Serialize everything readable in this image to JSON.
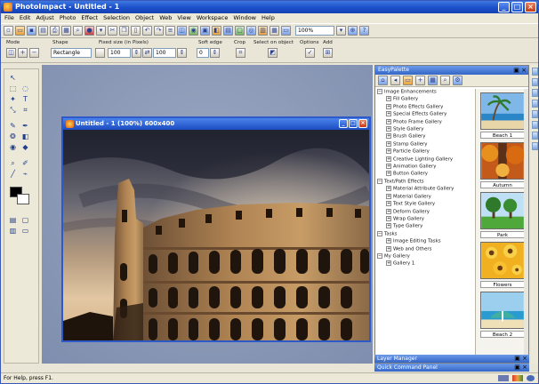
{
  "window": {
    "title": "PhotoImpact - Untitled - 1",
    "buttons": [
      "_",
      "□",
      "×"
    ]
  },
  "menu": [
    "File",
    "Edit",
    "Adjust",
    "Photo",
    "Effect",
    "Selection",
    "Object",
    "Web",
    "View",
    "Workspace",
    "Window",
    "Help"
  ],
  "toolbar": {
    "zoom": "100%"
  },
  "attribute_bar": {
    "mode_label": "Mode",
    "shape_label": "Shape",
    "shape_value": "Rectangle",
    "fixed_size_label": "Fixed size (in Pixels)",
    "width_value": "100",
    "height_value": "100",
    "soft_edge_label": "Soft edge",
    "soft_edge_value": "0",
    "crop_label": "Crop",
    "select_on_object_label": "Select on object",
    "options_label": "Options",
    "add_label": "Add"
  },
  "document": {
    "title": "Untitled - 1 (100%) 600x400"
  },
  "easypalette": {
    "title": "EasyPalette",
    "tree": [
      {
        "label": "Image Enhancements",
        "level": 0
      },
      {
        "label": "Fill Gallery",
        "level": 1
      },
      {
        "label": "Photo Effects Gallery",
        "level": 1
      },
      {
        "label": "Special Effects Gallery",
        "level": 1
      },
      {
        "label": "Photo Frame Gallery",
        "level": 1
      },
      {
        "label": "Style Gallery",
        "level": 1
      },
      {
        "label": "Brush Gallery",
        "level": 1
      },
      {
        "label": "Stamp Gallery",
        "level": 1
      },
      {
        "label": "Particle Gallery",
        "level": 1
      },
      {
        "label": "Creative Lighting Gallery",
        "level": 1
      },
      {
        "label": "Animation Gallery",
        "level": 1
      },
      {
        "label": "Button Gallery",
        "level": 1
      },
      {
        "label": "Text/Path Effects",
        "level": 0
      },
      {
        "label": "Material Attribute Gallery",
        "level": 1
      },
      {
        "label": "Material Gallery",
        "level": 1
      },
      {
        "label": "Text Style Gallery",
        "level": 1
      },
      {
        "label": "Deform Gallery",
        "level": 1
      },
      {
        "label": "Wrap Gallery",
        "level": 1
      },
      {
        "label": "Type Gallery",
        "level": 1
      },
      {
        "label": "Tasks",
        "level": 0
      },
      {
        "label": "Image Editing Tasks",
        "level": 1
      },
      {
        "label": "Web and Others",
        "level": 1
      },
      {
        "label": "My Gallery",
        "level": 0
      },
      {
        "label": "Gallery 1",
        "level": 1
      }
    ],
    "thumbnails": [
      "Beach 1",
      "Autumn",
      "Park",
      "Flowers",
      "Beach 2"
    ]
  },
  "panels": {
    "layer_manager": "Layer Manager",
    "quick_command": "Quick Command Panel"
  },
  "status": {
    "text": "For Help, press F1."
  }
}
